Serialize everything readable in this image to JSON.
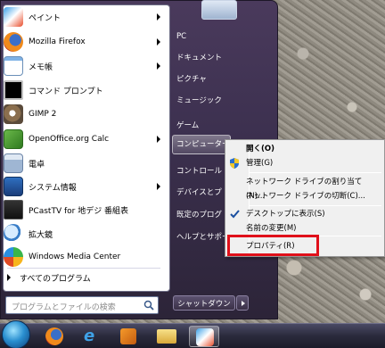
{
  "start_menu": {
    "programs": [
      {
        "label": "ペイント",
        "icon": "paint-icon",
        "has_submenu": true
      },
      {
        "label": "Mozilla Firefox",
        "icon": "firefox-icon",
        "has_submenu": true
      },
      {
        "label": "メモ帳",
        "icon": "notepad-icon",
        "has_submenu": true
      },
      {
        "label": "コマンド プロンプト",
        "icon": "command-prompt-icon",
        "has_submenu": false
      },
      {
        "label": "GIMP 2",
        "icon": "gimp-icon",
        "has_submenu": false
      },
      {
        "label": "OpenOffice.org Calc",
        "icon": "calc-icon",
        "has_submenu": true
      },
      {
        "label": "電卓",
        "icon": "calculator-icon",
        "has_submenu": false
      },
      {
        "label": "システム情報",
        "icon": "system-info-icon",
        "has_submenu": true
      },
      {
        "label": "PCastTV for 地デジ 番組表",
        "icon": "pcasttv-icon",
        "has_submenu": false
      },
      {
        "label": "拡大鏡",
        "icon": "magnifier-icon",
        "has_submenu": false
      },
      {
        "label": "Windows Media Center",
        "icon": "media-center-icon",
        "has_submenu": false
      }
    ],
    "all_programs": "すべてのプログラム",
    "search_placeholder": "プログラムとファイルの検索",
    "right_items": [
      {
        "label": "PC"
      },
      {
        "label": "ドキュメント"
      },
      {
        "label": "ピクチャ"
      },
      {
        "label": "ミュージック"
      },
      {
        "label": "ゲーム"
      },
      {
        "label": "コンピューター"
      },
      {
        "label": "コントロール"
      },
      {
        "label": "デバイスとプ"
      },
      {
        "label": "既定のプログ"
      },
      {
        "label": "ヘルプとサポー"
      }
    ],
    "shutdown_label": "シャットダウン"
  },
  "context_menu": {
    "items": [
      {
        "label": "開く(O)",
        "bold": true
      },
      {
        "label": "管理(G)",
        "icon": "shield-icon"
      },
      {
        "label": "ネットワーク ドライブの割り当て(N)..."
      },
      {
        "label": "ネットワーク ドライブの切断(C)..."
      },
      {
        "label": "デスクトップに表示(S)",
        "checked": true
      },
      {
        "label": "名前の変更(M)"
      },
      {
        "label": "プロパティ(R)",
        "highlighted": true
      }
    ]
  },
  "taskbar": {
    "items": [
      "start-orb",
      "firefox-icon",
      "ie-icon",
      "media-player-icon",
      "explorer-icon",
      "paint-icon"
    ]
  },
  "colors": {
    "highlight_box": "#e0101a",
    "start_menu_bg": "#3d3150"
  }
}
